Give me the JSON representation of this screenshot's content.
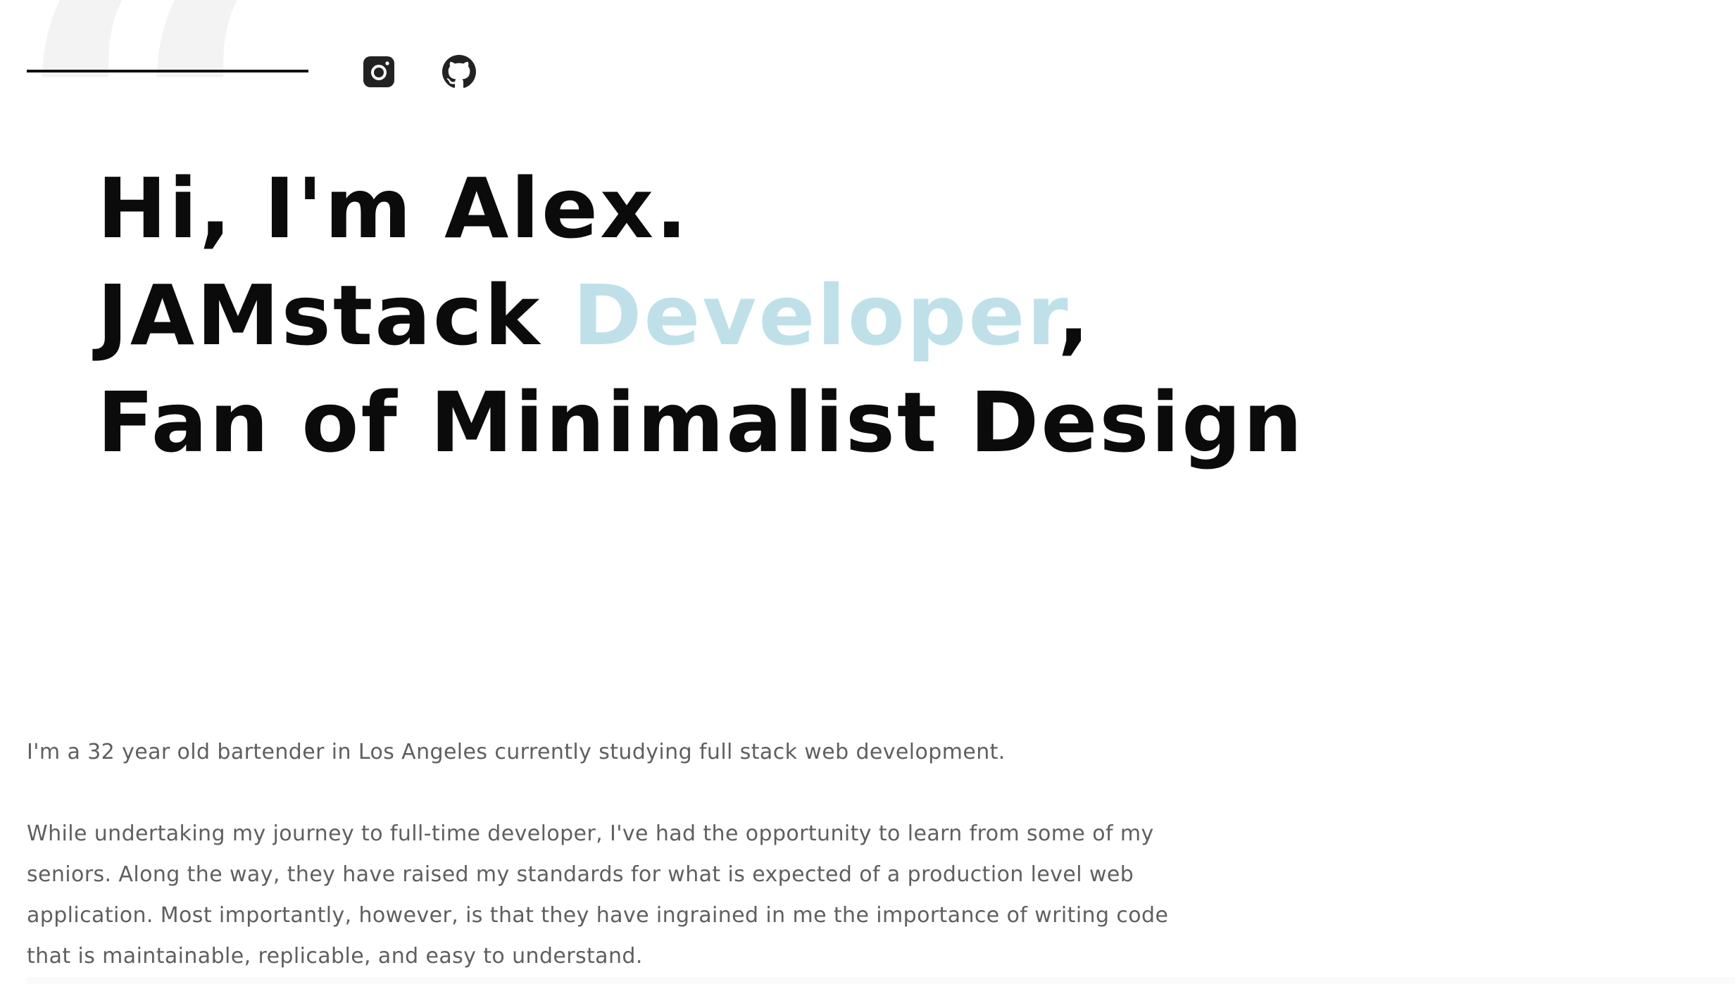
{
  "decor": {
    "quote_glyph": "“"
  },
  "header": {
    "social": [
      {
        "name": "instagram",
        "icon": "instagram-icon"
      },
      {
        "name": "github",
        "icon": "github-icon"
      }
    ]
  },
  "hero": {
    "line1": "Hi, I'm Alex.",
    "line2_prefix": "JAMstack ",
    "line2_accent": "Developer",
    "line2_suffix": ",",
    "line3": "Fan of Minimalist Design"
  },
  "about": {
    "paragraph1": "I'm a 32 year old bartender in Los Angeles currently studying full stack web development.",
    "paragraph2": "While undertaking my journey to full-time developer, I've had the opportunity to learn from some of my seniors. Along the way, they have raised my standards for what is expected of a production level web application. Most importantly, however, is that they have ingrained in me the importance of writing code that is maintainable, replicable, and easy to understand."
  },
  "colors": {
    "heading": "#0b0b0b",
    "accent": "#bfe0e8",
    "body_text": "#5f5f5f",
    "quote_mark": "#f3f3f3",
    "icon": "#222222"
  }
}
